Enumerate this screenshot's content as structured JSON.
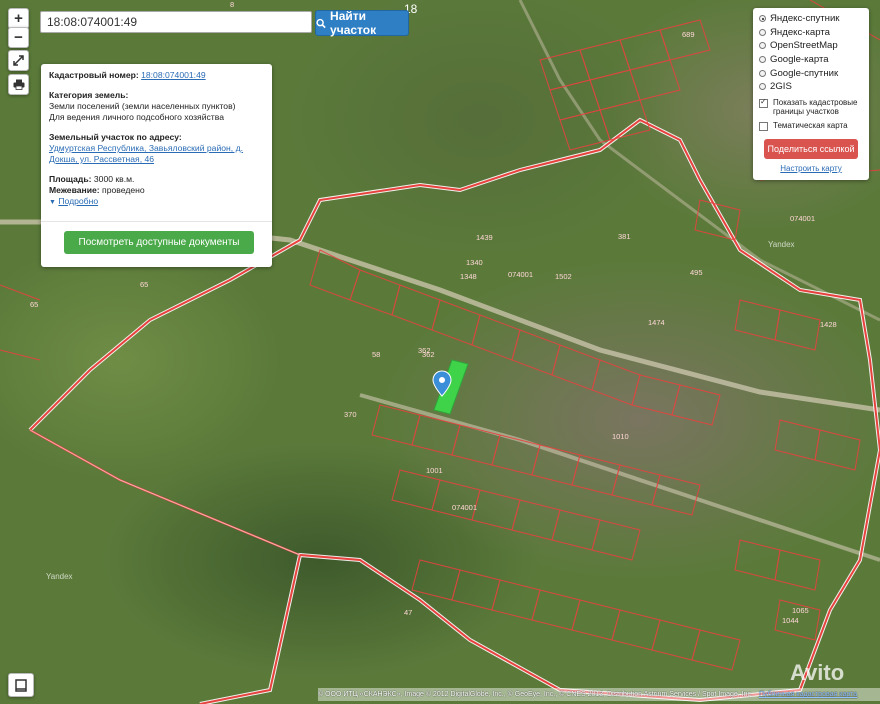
{
  "search": {
    "value": "18:08:074001:49",
    "button_label": "Найти участок",
    "button_icon": "search-icon"
  },
  "map_controls": {
    "zoom_in": "+",
    "zoom_out": "−",
    "fullscreen_icon": "expand-icon",
    "print_icon": "printer-icon",
    "bottom_icon": "book-icon"
  },
  "map_labels": {
    "top_number": "18",
    "top_number_left": "8",
    "quarter_1": "074001",
    "quarter_2": "074001",
    "quarter_3": "074001",
    "yandex_1": "Yandex",
    "yandex_2": "Yandex",
    "parcel_numbers": [
      "65",
      "65",
      "58",
      "362",
      "1348",
      "1340",
      "1502",
      "1439",
      "1474",
      "689",
      "495",
      "381",
      "1001",
      "1010",
      "1065",
      "1044",
      "370",
      "1428",
      "47",
      "362"
    ]
  },
  "info_panel": {
    "cad_label": "Кадастровый номер:",
    "cad_value": "18:08:074001:49",
    "cat_label": "Категория земель:",
    "cat_line1": "Земли поселений (земли населенных пунктов)",
    "cat_line2": "Для ведения личного подсобного хозяйства",
    "addr_label": "Земельный участок по адресу:",
    "addr_value": "Удмуртская Республика, Завьяловский район, д. Докша, ул. Рассветная, 46",
    "area_label": "Площадь:",
    "area_value": "3000 кв.м.",
    "survey_label": "Межевание:",
    "survey_value": "проведено",
    "more_label": "Подробно",
    "docs_button": "Посмотреть доступные документы"
  },
  "layers_panel": {
    "options": [
      {
        "label": "Яндекс-спутник",
        "selected": true
      },
      {
        "label": "Яндекс-карта",
        "selected": false
      },
      {
        "label": "OpenStreetMap",
        "selected": false
      },
      {
        "label": "Google-карта",
        "selected": false
      },
      {
        "label": "Google-спутник",
        "selected": false
      },
      {
        "label": "2GIS",
        "selected": false
      }
    ],
    "show_borders_label": "Показать кадастровые границы участков",
    "show_borders_checked": true,
    "thematic_label": "Тематическая карта",
    "thematic_checked": false,
    "share_button": "Поделиться ссылкой",
    "configure_link": "Настроить карту"
  },
  "attribution": {
    "text": "© ООО ИТЦ «СКАНЭКС», Image © 2012 DigitalGlobe, Inc., © GeoEye, Inc., © CNES 2013, Distribution Astrium Services / Spot Image, Inc.",
    "pkk_link": "Публичная кадастровая карта"
  },
  "watermark": "Avito",
  "colors": {
    "search_button": "#2f7fc4",
    "docs_button": "#4aaa4a",
    "share_button": "#d9534f",
    "boundary": "#e8423f",
    "selected_parcel": "#3fd34a",
    "link": "#2a6bb5"
  }
}
